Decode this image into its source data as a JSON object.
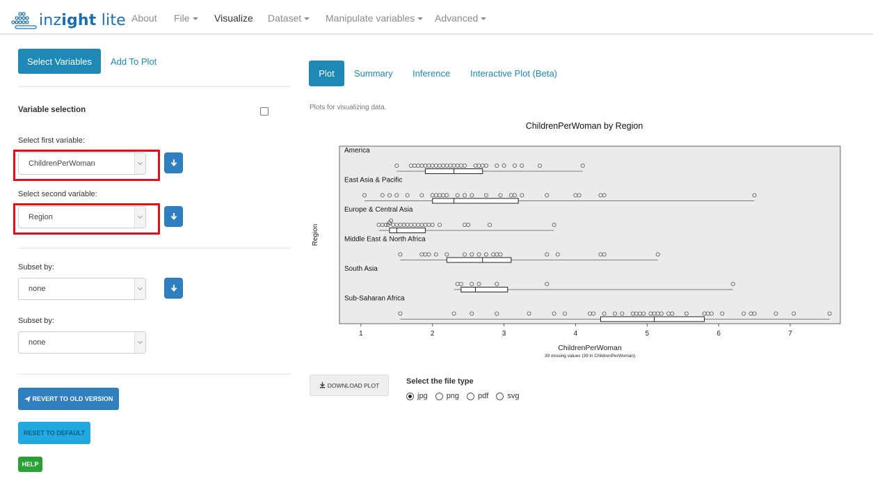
{
  "navbar": {
    "logo": {
      "text_prefix": "inz",
      "text_bold": "i",
      "text_rest": "ght",
      "text_suffix": " lite"
    },
    "items": [
      {
        "label": "About",
        "has_caret": false,
        "active": false
      },
      {
        "label": "File",
        "has_caret": true,
        "active": false
      },
      {
        "label": "Visualize",
        "has_caret": false,
        "active": true
      },
      {
        "label": "Dataset",
        "has_caret": true,
        "active": false
      },
      {
        "label": "Manipulate variables",
        "has_caret": true,
        "active": false
      },
      {
        "label": "Advanced",
        "has_caret": true,
        "active": false
      }
    ]
  },
  "sidebar": {
    "tabs": {
      "select_variables": "Select Variables",
      "add_to_plot": "Add To Plot"
    },
    "variable_selection": "Variable selection",
    "first_label": "Select first variable:",
    "first_value": "ChildrenPerWoman",
    "second_label": "Select second variable:",
    "second_value": "Region",
    "subset1_label": "Subset by:",
    "subset1_value": "none",
    "subset2_label": "Subset by:",
    "subset2_value": "none",
    "revert_label": "REVERT TO OLD VERSION",
    "reset_label": "RESET TO DEFAULT",
    "help_label": "HELP"
  },
  "main": {
    "tabs": [
      {
        "label": "Plot",
        "active": true
      },
      {
        "label": "Summary",
        "active": false
      },
      {
        "label": "Inference",
        "active": false
      },
      {
        "label": "Interactive Plot (Beta)",
        "active": false
      }
    ],
    "description": "Plots for visualizing data.",
    "download_label": "DOWNLOAD PLOT",
    "file_type_label": "Select the file type",
    "file_types": [
      {
        "label": "jpg",
        "selected": true
      },
      {
        "label": "png",
        "selected": false
      },
      {
        "label": "pdf",
        "selected": false
      },
      {
        "label": "svg",
        "selected": false
      }
    ]
  },
  "chart_data": {
    "type": "dot-box",
    "title": "ChildrenPerWoman by Region",
    "xlabel": "ChildrenPerWoman",
    "ylabel": "Region",
    "note": "39 missing values (39 in ChildrenPerWoman)",
    "xlim": [
      0.7,
      7.7
    ],
    "xticks": [
      1,
      2,
      3,
      4,
      5,
      6,
      7
    ],
    "groups": [
      {
        "name": "America",
        "min": 1.5,
        "q1": 1.9,
        "median": 2.3,
        "q3": 2.7,
        "max": 4.1,
        "points": [
          1.5,
          1.7,
          1.75,
          1.8,
          1.85,
          1.9,
          1.95,
          2.0,
          2.05,
          2.1,
          2.15,
          2.2,
          2.25,
          2.3,
          2.35,
          2.4,
          2.45,
          2.6,
          2.65,
          2.7,
          2.75,
          2.9,
          3.0,
          3.15,
          3.25,
          3.5,
          4.1
        ]
      },
      {
        "name": "East Asia & Pacific",
        "min": 1.05,
        "q1": 2.0,
        "median": 2.3,
        "q3": 3.2,
        "max": 6.5,
        "points": [
          1.05,
          1.3,
          1.4,
          1.5,
          1.65,
          1.85,
          2.0,
          2.05,
          2.1,
          2.15,
          2.2,
          2.35,
          2.45,
          2.55,
          2.75,
          2.95,
          3.1,
          3.15,
          3.25,
          3.6,
          4.0,
          4.05,
          4.35,
          4.4,
          6.5
        ]
      },
      {
        "name": "Europe & Central Asia",
        "min": 1.25,
        "q1": 1.4,
        "median": 1.5,
        "q3": 1.9,
        "max": 3.7,
        "points": [
          1.25,
          1.3,
          1.35,
          1.38,
          1.4,
          1.42,
          1.45,
          1.5,
          1.55,
          1.6,
          1.65,
          1.7,
          1.75,
          1.8,
          1.85,
          1.9,
          1.95,
          2.0,
          2.1,
          2.45,
          2.5,
          2.8,
          3.7
        ]
      },
      {
        "name": "Middle East & North Africa",
        "min": 1.55,
        "q1": 2.2,
        "median": 2.7,
        "q3": 3.1,
        "max": 5.15,
        "points": [
          1.55,
          1.85,
          1.9,
          1.95,
          2.05,
          2.2,
          2.45,
          2.55,
          2.65,
          2.75,
          2.85,
          2.9,
          2.95,
          3.6,
          3.75,
          4.35,
          4.4,
          5.15
        ]
      },
      {
        "name": "South Asia",
        "min": 2.3,
        "q1": 2.4,
        "median": 2.6,
        "q3": 3.05,
        "max": 6.2,
        "points": [
          2.35,
          2.4,
          2.55,
          2.65,
          2.9,
          3.6,
          6.2
        ]
      },
      {
        "name": "Sub-Saharan Africa",
        "min": 1.55,
        "q1": 4.35,
        "median": 5.1,
        "q3": 5.8,
        "max": 7.55,
        "points": [
          1.55,
          2.3,
          2.55,
          2.9,
          3.35,
          3.7,
          3.85,
          4.2,
          4.25,
          4.4,
          4.55,
          4.65,
          4.8,
          4.85,
          4.9,
          4.95,
          5.05,
          5.1,
          5.15,
          5.2,
          5.3,
          5.35,
          5.55,
          5.8,
          5.85,
          5.9,
          6.05,
          6.35,
          6.45,
          6.5,
          6.8,
          7.05,
          7.55
        ]
      }
    ]
  }
}
